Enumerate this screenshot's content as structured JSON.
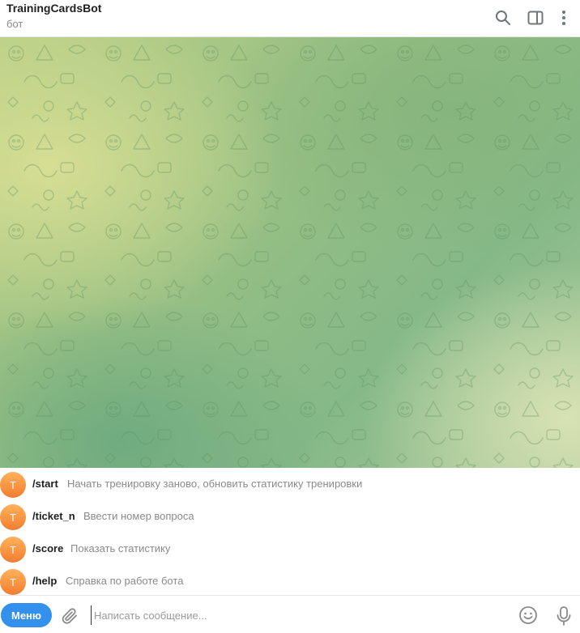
{
  "header": {
    "title": "TrainingCardsBot",
    "subtitle": "бот",
    "icons": [
      "search-icon",
      "sidebar-toggle-icon",
      "more-vert-icon"
    ]
  },
  "wallpaper": {
    "colors": [
      "#d6de93",
      "#94be84",
      "#6fab7f",
      "#d8e2b4"
    ]
  },
  "commands": [
    {
      "avatar_letter": "T",
      "command": "/start",
      "description": "Начать тренировку заново, обновить статистику тренировки"
    },
    {
      "avatar_letter": "T",
      "command": "/ticket_n",
      "description": "Ввести номер вопроса"
    },
    {
      "avatar_letter": "T",
      "command": "/score",
      "description": "Показать статистику"
    },
    {
      "avatar_letter": "T",
      "command": "/help",
      "description": "Справка по работе бота"
    }
  ],
  "composer": {
    "menu_label": "Меню",
    "placeholder": "Написать сообщение...",
    "value": "",
    "icons": [
      "paperclip-icon",
      "emoji-icon",
      "microphone-icon"
    ]
  },
  "colors": {
    "accent": "#3390ec",
    "avatar": "#f58b3a"
  }
}
